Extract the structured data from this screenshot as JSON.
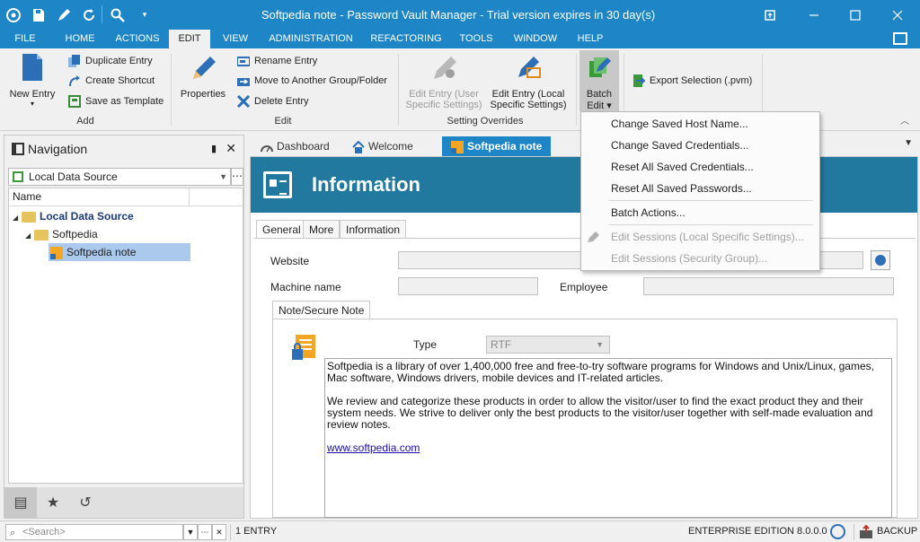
{
  "window": {
    "title": "Softpedia note - Password Vault Manager - Trial version expires in 30 day(s)",
    "accent_color": "#1e86c6",
    "banner_color": "#21799f"
  },
  "quick_access": [
    "app-icon",
    "save-icon",
    "edit-icon",
    "refresh-icon",
    "search-icon",
    "customize-dropdown-icon"
  ],
  "menu": {
    "items": [
      "FILE",
      "HOME",
      "ACTIONS",
      "EDIT",
      "VIEW",
      "ADMINISTRATION",
      "REFACTORING",
      "TOOLS",
      "WINDOW",
      "HELP"
    ],
    "active": "EDIT"
  },
  "ribbon": {
    "add": {
      "label": "Add",
      "new_entry": "New Entry",
      "duplicate": "Duplicate Entry",
      "shortcut": "Create Shortcut",
      "template": "Save as Template"
    },
    "edit": {
      "label": "Edit",
      "properties": "Properties",
      "rename": "Rename Entry",
      "move": "Move to Another Group/Folder",
      "delete": "Delete Entry"
    },
    "overrides": {
      "label": "Setting Overrides",
      "user_line1": "Edit Entry (User",
      "user_line2": "Specific Settings)",
      "local_line1": "Edit Entry (Local",
      "local_line2": "Specific Settings)"
    },
    "batch": {
      "line1": "Batch",
      "line2": "Edit ▾"
    },
    "export": "Export Selection (.pvm)"
  },
  "navigation": {
    "title": "Navigation",
    "data_source": "Local Data Source",
    "column": "Name",
    "tree": {
      "root": "Local Data Source",
      "folder": "Softpedia",
      "entry": "Softpedia note"
    },
    "bottom_tabs": [
      "entries-icon",
      "favorites-star-icon",
      "history-icon"
    ]
  },
  "doc_tabs": {
    "dashboard": "Dashboard",
    "welcome": "Welcome",
    "note": "Softpedia note"
  },
  "content": {
    "banner_title": "Information",
    "tabs": [
      "General",
      "More",
      "Information"
    ],
    "website_label": "Website",
    "website_value": "",
    "machine_label": "Machine name",
    "machine_value": "",
    "employee_label": "Employee",
    "employee_value": "",
    "note_tab": "Note/Secure Note",
    "type_label": "Type",
    "type_value": "RTF",
    "note_p1": "Softpedia is a library of over 1,400,000 free and free-to-try software programs for Windows and Unix/Linux, games, Mac software, Windows drivers, mobile devices and IT-related articles.",
    "note_p2": "We review and categorize these products in order to allow the visitor/user to find the exact product they and their system needs. We strive to deliver only the best products to the visitor/user together with self-made evaluation and review notes.",
    "note_link": "www.softpedia.com"
  },
  "dropdown": {
    "items": [
      {
        "label": "Change Saved Host Name...",
        "enabled": true
      },
      {
        "label": "Change Saved Credentials...",
        "enabled": true
      },
      {
        "label": "Reset All Saved Credentials...",
        "enabled": true
      },
      {
        "label": "Reset All Saved Passwords...",
        "enabled": true
      },
      {
        "label": "Batch Actions...",
        "enabled": true
      },
      {
        "label": "Edit Sessions (Local Specific Settings)...",
        "enabled": false
      },
      {
        "label": "Edit Sessions (Security Group)...",
        "enabled": false
      }
    ]
  },
  "status": {
    "search_placeholder": "<Search>",
    "entry_count": "1 ENTRY",
    "edition": "ENTERPRISE EDITION 8.0.0.0",
    "backup": "BACKUP"
  }
}
